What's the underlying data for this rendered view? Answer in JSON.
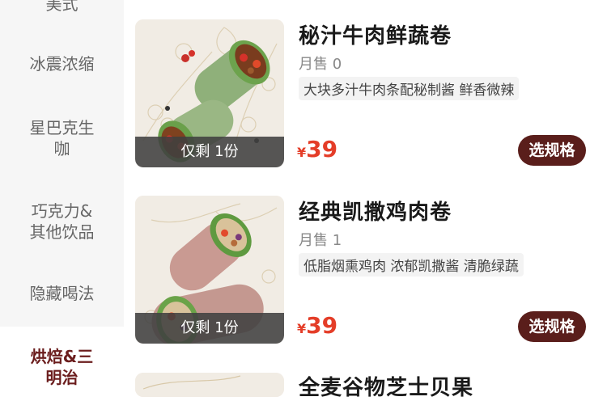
{
  "sidebar": {
    "categories": [
      {
        "label": "美式"
      },
      {
        "label": "冰震浓缩"
      },
      {
        "label_line1": "星巴克生",
        "label_line2": "咖"
      },
      {
        "label_line1": "巧克力&",
        "label_line2": "其他饮品"
      },
      {
        "label": "隐藏喝法"
      },
      {
        "label_line1": "烘焙&三",
        "label_line2": "明治"
      }
    ]
  },
  "products": [
    {
      "name": "秘汁牛肉鲜蔬卷",
      "sold": "月售 0",
      "tag": "大块多汁牛肉条配秘制酱 鲜香微辣",
      "currency": "¥",
      "price": "39",
      "stock": "仅剩 1份",
      "button": "选规格",
      "image_icon": "beef-wrap-image"
    },
    {
      "name": "经典凯撒鸡肉卷",
      "sold": "月售 1",
      "tag": "低脂烟熏鸡肉 浓郁凯撒酱 清脆绿蔬",
      "currency": "¥",
      "price": "39",
      "stock": "仅剩 1份",
      "button": "选规格",
      "image_icon": "chicken-wrap-image"
    },
    {
      "name": "全麦谷物芝士贝果",
      "image_icon": "bagel-image"
    }
  ],
  "colors": {
    "accent_price": "#e43d28",
    "button_bg": "#5a1e1b",
    "active_category": "#6b1d1d"
  }
}
